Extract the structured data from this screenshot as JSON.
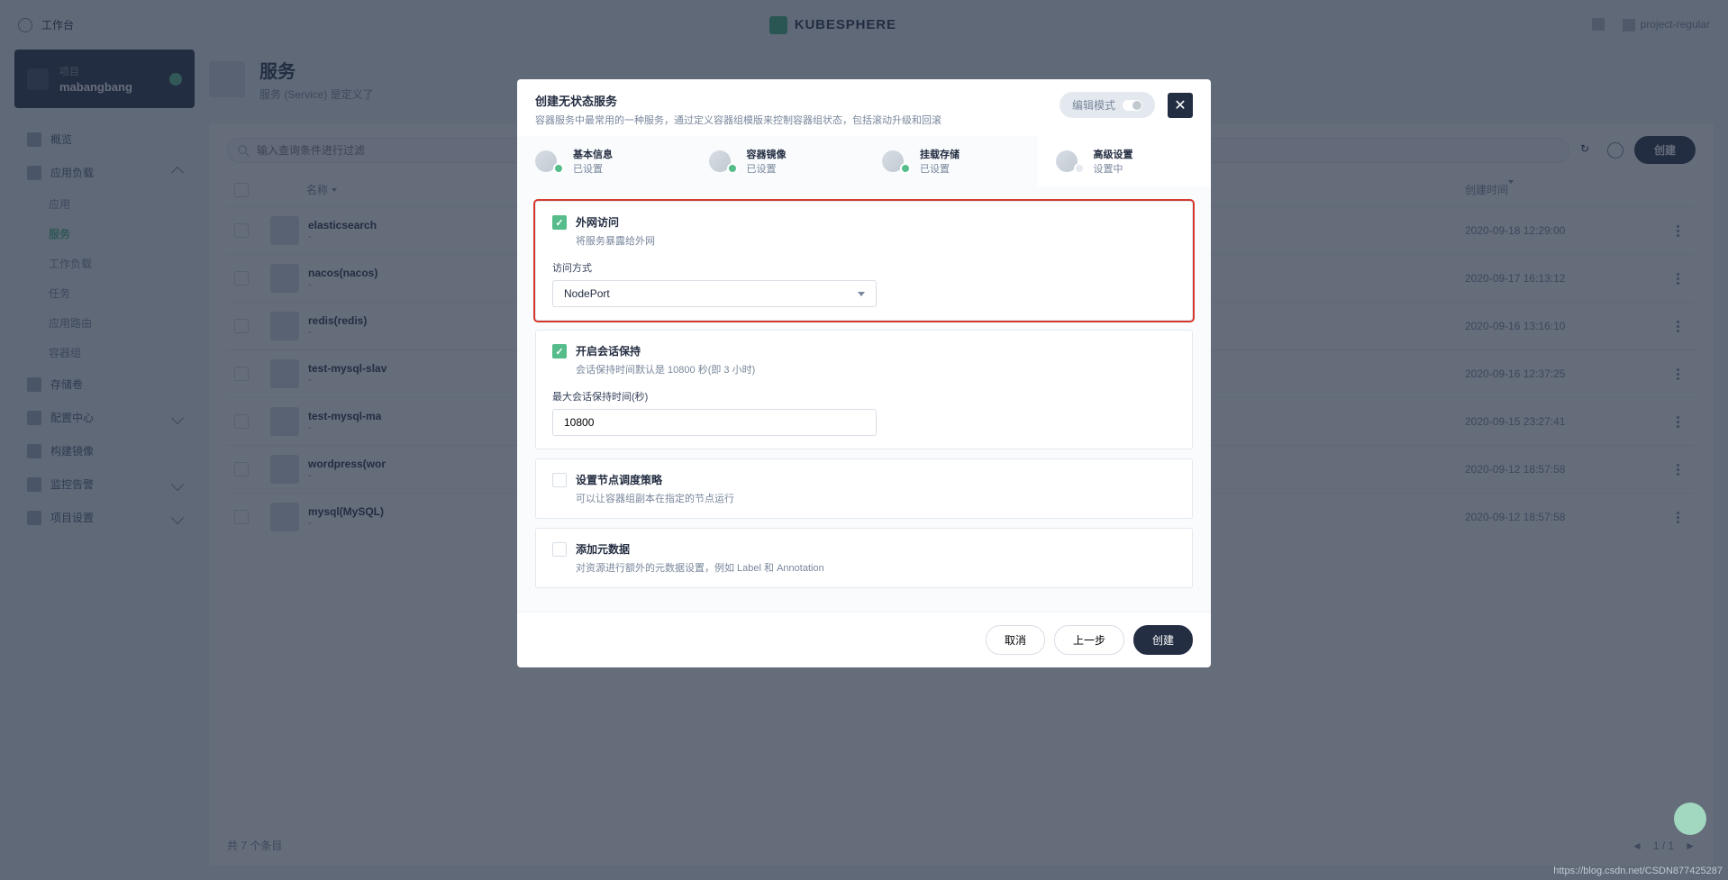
{
  "header": {
    "workbench": "工作台",
    "brand": "KUBESPHERE",
    "user": "project-regular"
  },
  "sidebar": {
    "project_label": "项目",
    "project_name": "mabangbang",
    "nav": {
      "overview": "概览",
      "workloads": "应用负载",
      "storage": "存储卷",
      "config": "配置中心",
      "build": "构建镜像",
      "monitor": "监控告警",
      "settings": "项目设置",
      "sub": {
        "apps": "应用",
        "services": "服务",
        "workloads": "工作负载",
        "jobs": "任务",
        "routes": "应用路由",
        "pods": "容器组"
      }
    }
  },
  "page": {
    "title": "服务",
    "subtitle": "服务 (Service) 是定义了",
    "search_placeholder": "输入查询条件进行过滤",
    "create_btn": "创建",
    "table": {
      "name_header": "名称",
      "time_header": "创建时间",
      "rows": [
        {
          "name": "elasticsearch",
          "time": "2020-09-18 12:29:00"
        },
        {
          "name": "nacos(nacos)",
          "time": "2020-09-17 16:13:12"
        },
        {
          "name": "redis(redis)",
          "time": "2020-09-16 13:16:10"
        },
        {
          "name": "test-mysql-slav",
          "time": "2020-09-16 12:37:25"
        },
        {
          "name": "test-mysql-ma",
          "time": "2020-09-15 23:27:41"
        },
        {
          "name": "wordpress(wor",
          "time": "2020-09-12 18:57:58"
        },
        {
          "name": "mysql(MySQL)",
          "time": "2020-09-12 18:57:58"
        }
      ],
      "total": "共 7 个条目",
      "pagination": "1 / 1"
    }
  },
  "modal": {
    "title": "创建无状态服务",
    "subtitle": "容器服务中最常用的一种服务，通过定义容器组模版来控制容器组状态，包括滚动升级和回滚",
    "edit_mode": "编辑模式",
    "steps": [
      {
        "title": "基本信息",
        "status": "已设置"
      },
      {
        "title": "容器镜像",
        "status": "已设置"
      },
      {
        "title": "挂载存储",
        "status": "已设置"
      },
      {
        "title": "高级设置",
        "status": "设置中"
      }
    ],
    "form": {
      "external_access": {
        "title": "外网访问",
        "desc": "将服务暴露给外网"
      },
      "access_method_label": "访问方式",
      "access_method_value": "NodePort",
      "session": {
        "title": "开启会话保持",
        "desc": "会话保持时间默认是 10800 秒(即 3 小时)"
      },
      "session_label": "最大会话保持时间(秒)",
      "session_value": "10800",
      "scheduling": {
        "title": "设置节点调度策略",
        "desc": "可以让容器组副本在指定的节点运行"
      },
      "metadata": {
        "title": "添加元数据",
        "desc": "对资源进行额外的元数据设置，例如 Label 和 Annotation"
      }
    },
    "footer": {
      "cancel": "取消",
      "prev": "上一步",
      "create": "创建"
    }
  },
  "watermark": "https://blog.csdn.net/CSDN877425287"
}
